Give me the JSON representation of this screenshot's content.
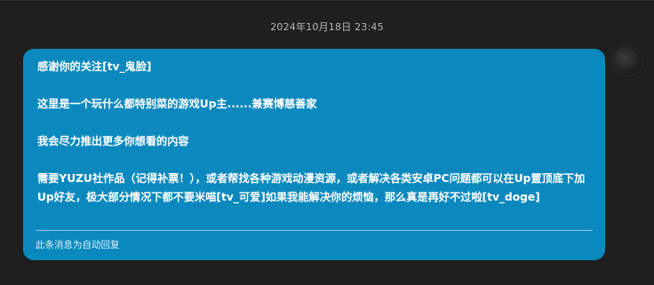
{
  "chat": {
    "timestamp": "2024年10月18日 23:45",
    "bubble": {
      "message": "感谢你的关注[tv_鬼脸]\n\n这里是一个玩什么都特别菜的游戏Up主......兼赛博慈善家\n\n我会尽力推出更多你想看的内容\n\n需要YUZU社作品（记得补票！），或者帮找各种游戏动漫资源，或者解决各类安卓PC问题都可以在Up置顶底下加Up好友，极大部分情况下都不要米喵[tv_可爱]如果我能解决你的烦恼，那么真是再好不过啦[tv_doge]",
      "footer": "此条消息为自动回复"
    }
  },
  "colors": {
    "background": "#1f1f1f",
    "bubble": "#0b89bf",
    "text": "#ffffff",
    "timestamp": "#b9b9b9"
  }
}
